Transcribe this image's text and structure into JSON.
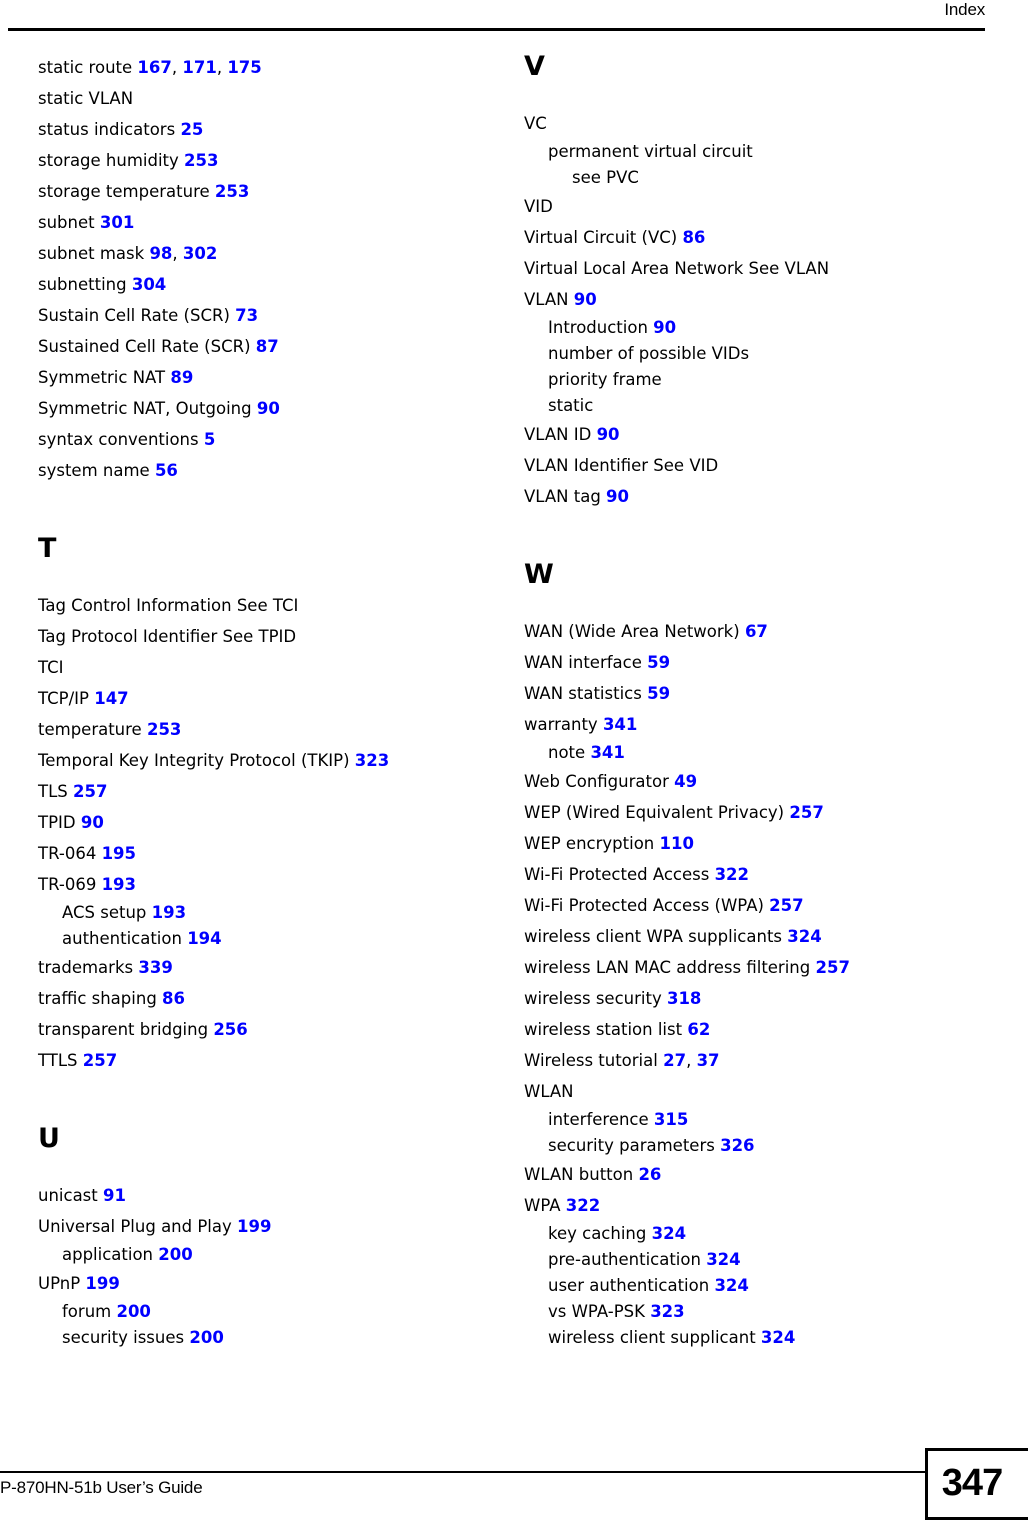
{
  "header": {
    "title": "Index"
  },
  "footer": {
    "doc_title": "P-870HN-51b User’s Guide",
    "page_number": "347"
  },
  "colors": {
    "page_number_link": "#0000FF",
    "text": "#000000",
    "background": "#FFFFFF"
  },
  "columns": [
    {
      "name": "left-column",
      "blocks": [
        {
          "letter": null,
          "entries": [
            {
              "level": 0,
              "text": "static route",
              "pages": [
                "167",
                "171",
                "175"
              ]
            },
            {
              "level": 0,
              "text": "static VLAN",
              "pages": []
            },
            {
              "level": 0,
              "text": "status indicators",
              "pages": [
                "25"
              ]
            },
            {
              "level": 0,
              "text": "storage humidity",
              "pages": [
                "253"
              ]
            },
            {
              "level": 0,
              "text": "storage temperature",
              "pages": [
                "253"
              ]
            },
            {
              "level": 0,
              "text": "subnet",
              "pages": [
                "301"
              ]
            },
            {
              "level": 0,
              "text": "subnet mask",
              "pages": [
                "98",
                "302"
              ]
            },
            {
              "level": 0,
              "text": "subnetting",
              "pages": [
                "304"
              ]
            },
            {
              "level": 0,
              "text": "Sustain Cell Rate (SCR)",
              "pages": [
                "73"
              ]
            },
            {
              "level": 0,
              "text": "Sustained Cell Rate (SCR)",
              "pages": [
                "87"
              ]
            },
            {
              "level": 0,
              "text": "Symmetric NAT",
              "pages": [
                "89"
              ]
            },
            {
              "level": 0,
              "text": "Symmetric NAT, Outgoing",
              "pages": [
                "90"
              ]
            },
            {
              "level": 0,
              "text": "syntax conventions",
              "pages": [
                "5"
              ]
            },
            {
              "level": 0,
              "text": "system name",
              "pages": [
                "56"
              ]
            }
          ]
        },
        {
          "letter": "T",
          "entries": [
            {
              "level": 0,
              "text": "Tag Control Information See TCI",
              "pages": []
            },
            {
              "level": 0,
              "text": "Tag Protocol Identifier See TPID",
              "pages": []
            },
            {
              "level": 0,
              "text": "TCI",
              "pages": []
            },
            {
              "level": 0,
              "text": "TCP/IP",
              "pages": [
                "147"
              ]
            },
            {
              "level": 0,
              "text": "temperature",
              "pages": [
                "253"
              ]
            },
            {
              "level": 0,
              "text": "Temporal Key Integrity Protocol (TKIP)",
              "pages": [
                "323"
              ]
            },
            {
              "level": 0,
              "text": "TLS",
              "pages": [
                "257"
              ]
            },
            {
              "level": 0,
              "text": "TPID",
              "pages": [
                "90"
              ]
            },
            {
              "level": 0,
              "text": "TR-064",
              "pages": [
                "195"
              ]
            },
            {
              "level": 0,
              "text": "TR-069",
              "pages": [
                "193"
              ]
            },
            {
              "level": 1,
              "text": "ACS setup",
              "pages": [
                "193"
              ]
            },
            {
              "level": 1,
              "text": "authentication",
              "pages": [
                "194"
              ]
            },
            {
              "level": 0,
              "text": "trademarks",
              "pages": [
                "339"
              ]
            },
            {
              "level": 0,
              "text": "traffic shaping",
              "pages": [
                "86"
              ]
            },
            {
              "level": 0,
              "text": "transparent bridging",
              "pages": [
                "256"
              ]
            },
            {
              "level": 0,
              "text": "TTLS",
              "pages": [
                "257"
              ]
            }
          ]
        },
        {
          "letter": "U",
          "entries": [
            {
              "level": 0,
              "text": "unicast",
              "pages": [
                "91"
              ]
            },
            {
              "level": 0,
              "text": "Universal Plug and Play",
              "pages": [
                "199"
              ]
            },
            {
              "level": 1,
              "text": "application",
              "pages": [
                "200"
              ]
            },
            {
              "level": 0,
              "text": "UPnP",
              "pages": [
                "199"
              ]
            },
            {
              "level": 1,
              "text": "forum",
              "pages": [
                "200"
              ]
            },
            {
              "level": 1,
              "text": "security issues",
              "pages": [
                "200"
              ]
            }
          ]
        }
      ]
    },
    {
      "name": "right-column",
      "blocks": [
        {
          "letter": "V",
          "entries": [
            {
              "level": 0,
              "text": "VC",
              "pages": []
            },
            {
              "level": 1,
              "text": "permanent virtual circuit",
              "pages": []
            },
            {
              "level": 2,
              "text": "see PVC",
              "pages": []
            },
            {
              "level": 0,
              "text": "VID",
              "pages": []
            },
            {
              "level": 0,
              "text": "Virtual Circuit (VC)",
              "pages": [
                "86"
              ]
            },
            {
              "level": 0,
              "text": "Virtual Local Area Network See VLAN",
              "pages": []
            },
            {
              "level": 0,
              "text": "VLAN",
              "pages": [
                "90"
              ]
            },
            {
              "level": 1,
              "text": "Introduction",
              "pages": [
                "90"
              ]
            },
            {
              "level": 1,
              "text": "number of possible VIDs",
              "pages": []
            },
            {
              "level": 1,
              "text": "priority frame",
              "pages": []
            },
            {
              "level": 1,
              "text": "static",
              "pages": []
            },
            {
              "level": 0,
              "text": "VLAN ID",
              "pages": [
                "90"
              ]
            },
            {
              "level": 0,
              "text": "VLAN Identifier See VID",
              "pages": []
            },
            {
              "level": 0,
              "text": "VLAN tag",
              "pages": [
                "90"
              ]
            }
          ]
        },
        {
          "letter": "W",
          "entries": [
            {
              "level": 0,
              "text": "WAN (Wide Area Network)",
              "pages": [
                "67"
              ]
            },
            {
              "level": 0,
              "text": "WAN interface",
              "pages": [
                "59"
              ]
            },
            {
              "level": 0,
              "text": "WAN statistics",
              "pages": [
                "59"
              ]
            },
            {
              "level": 0,
              "text": "warranty",
              "pages": [
                "341"
              ]
            },
            {
              "level": 1,
              "text": "note",
              "pages": [
                "341"
              ]
            },
            {
              "level": 0,
              "text": "Web Configurator",
              "pages": [
                "49"
              ]
            },
            {
              "level": 0,
              "text": "WEP (Wired Equivalent Privacy)",
              "pages": [
                "257"
              ]
            },
            {
              "level": 0,
              "text": "WEP encryption",
              "pages": [
                "110"
              ]
            },
            {
              "level": 0,
              "text": "Wi-Fi Protected Access",
              "pages": [
                "322"
              ]
            },
            {
              "level": 0,
              "text": "Wi-Fi Protected Access (WPA)",
              "pages": [
                "257"
              ]
            },
            {
              "level": 0,
              "text": "wireless client WPA supplicants",
              "pages": [
                "324"
              ]
            },
            {
              "level": 0,
              "text": "wireless LAN MAC address filtering",
              "pages": [
                "257"
              ]
            },
            {
              "level": 0,
              "text": "wireless security",
              "pages": [
                "318"
              ]
            },
            {
              "level": 0,
              "text": "wireless station list",
              "pages": [
                "62"
              ]
            },
            {
              "level": 0,
              "text": "Wireless tutorial",
              "pages": [
                "27",
                "37"
              ]
            },
            {
              "level": 0,
              "text": "WLAN",
              "pages": []
            },
            {
              "level": 1,
              "text": "interference",
              "pages": [
                "315"
              ]
            },
            {
              "level": 1,
              "text": "security parameters",
              "pages": [
                "326"
              ]
            },
            {
              "level": 0,
              "text": "WLAN button",
              "pages": [
                "26"
              ]
            },
            {
              "level": 0,
              "text": "WPA",
              "pages": [
                "322"
              ]
            },
            {
              "level": 1,
              "text": "key caching",
              "pages": [
                "324"
              ]
            },
            {
              "level": 1,
              "text": "pre-authentication",
              "pages": [
                "324"
              ]
            },
            {
              "level": 1,
              "text": "user authentication",
              "pages": [
                "324"
              ]
            },
            {
              "level": 1,
              "text": "vs WPA-PSK",
              "pages": [
                "323"
              ]
            },
            {
              "level": 1,
              "text": "wireless client supplicant",
              "pages": [
                "324"
              ]
            }
          ]
        }
      ]
    }
  ]
}
